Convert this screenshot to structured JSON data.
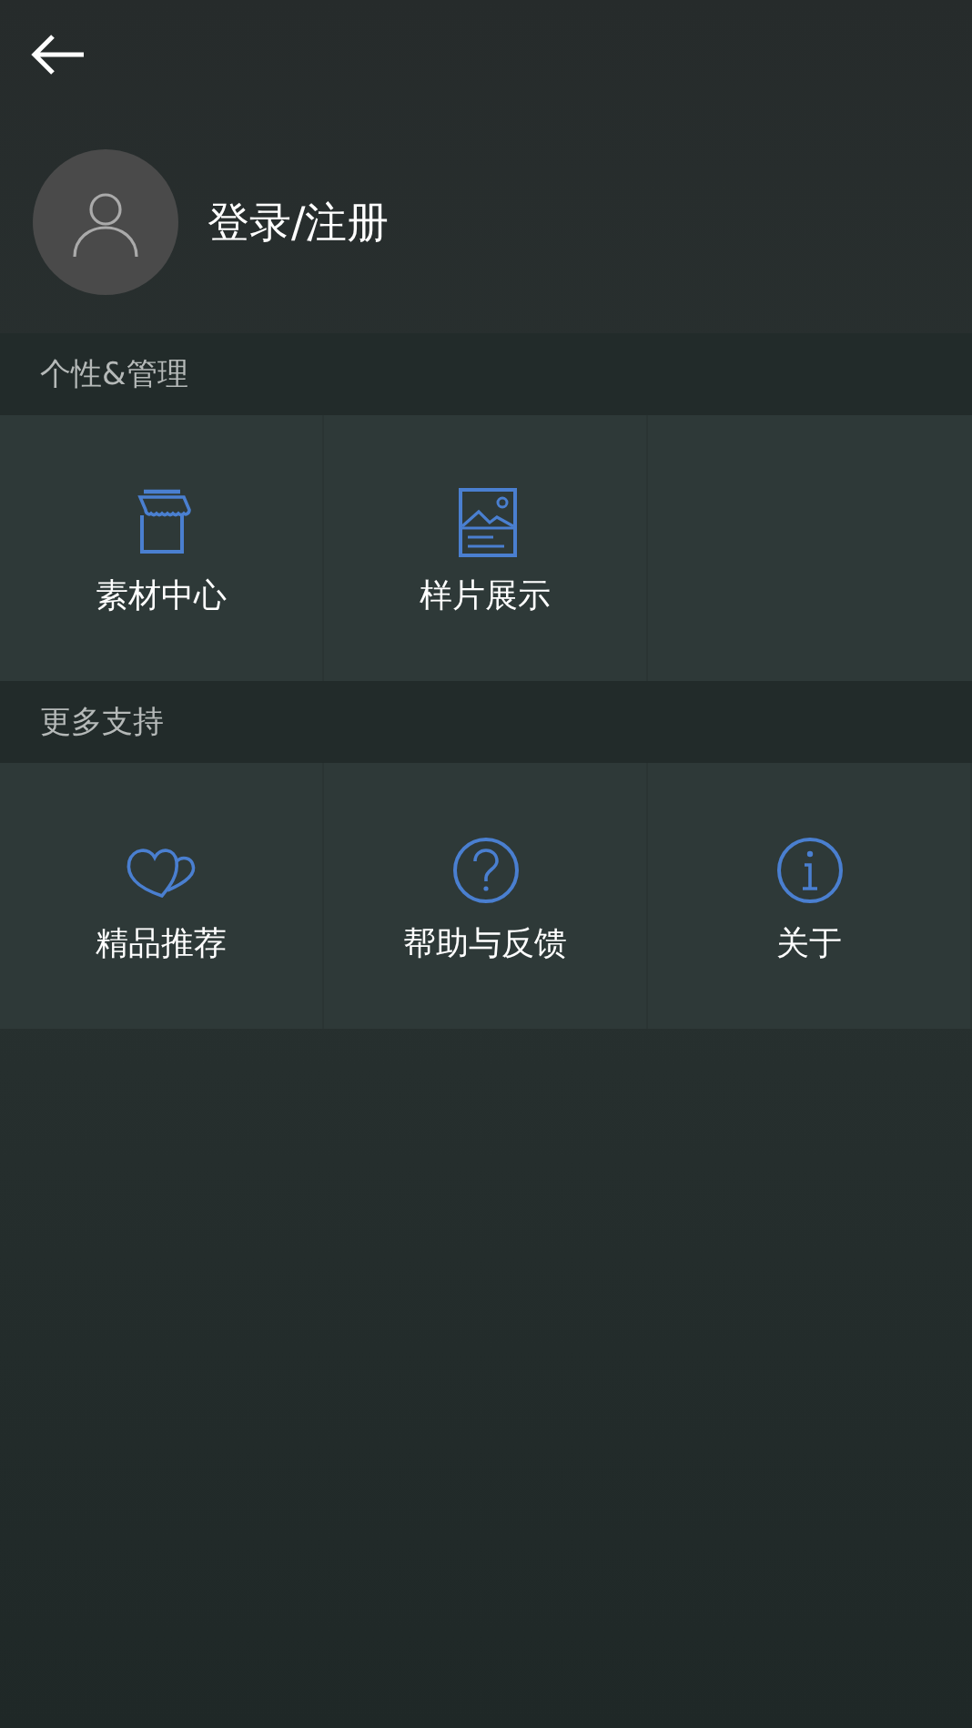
{
  "profile": {
    "login_label": "登录/注册"
  },
  "sections": [
    {
      "title": "个性&管理",
      "items": [
        {
          "label": "素材中心"
        },
        {
          "label": "样片展示"
        }
      ]
    },
    {
      "title": "更多支持",
      "items": [
        {
          "label": "精品推荐"
        },
        {
          "label": "帮助与反馈"
        },
        {
          "label": "关于"
        }
      ]
    }
  ]
}
